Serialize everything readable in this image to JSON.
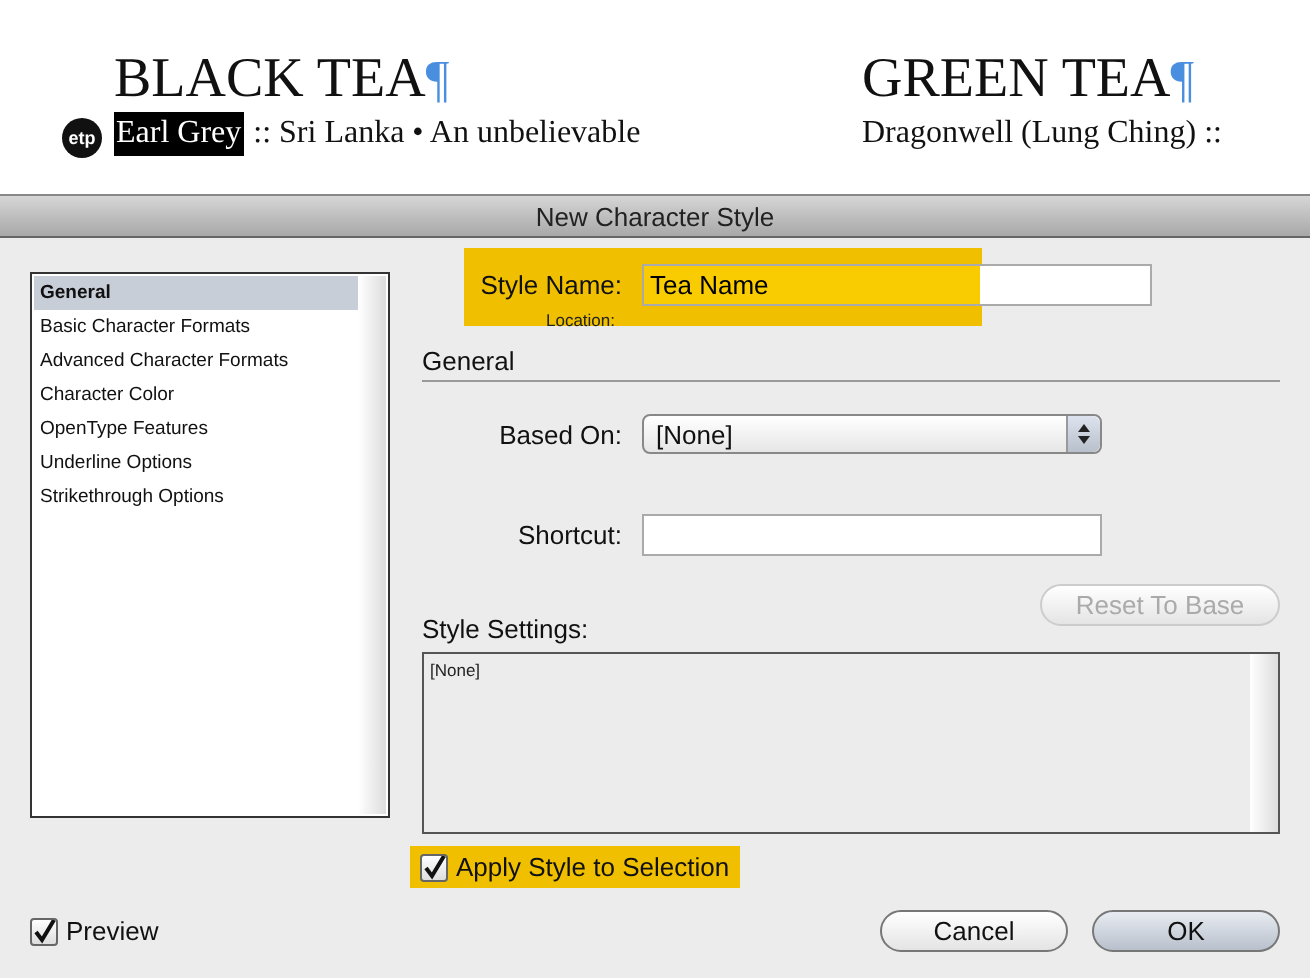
{
  "document": {
    "columns": [
      {
        "heading": "BLACK TEA",
        "pilcrow": "¶",
        "lines": [
          {
            "badge": "etp",
            "highlighted": "Earl Grey",
            "text": ":: Sri Lanka • An unbelievable"
          }
        ]
      },
      {
        "heading": "GREEN TEA",
        "pilcrow": "¶",
        "lines": [
          {
            "text": "Dragonwell (Lung Ching) ::"
          }
        ]
      }
    ]
  },
  "dialog": {
    "title": "New Character Style",
    "categories": [
      {
        "label": "General",
        "selected": true
      },
      {
        "label": "Basic Character Formats",
        "selected": false
      },
      {
        "label": "Advanced Character Formats",
        "selected": false
      },
      {
        "label": "Character Color",
        "selected": false
      },
      {
        "label": "OpenType Features",
        "selected": false
      },
      {
        "label": "Underline Options",
        "selected": false
      },
      {
        "label": "Strikethrough Options",
        "selected": false
      }
    ],
    "style_name": {
      "label": "Style Name:",
      "value": "Tea Name",
      "highlighted": true
    },
    "location_label": "Location:",
    "section": "General",
    "based_on": {
      "label": "Based On:",
      "value": "[None]"
    },
    "shortcut": {
      "label": "Shortcut:"
    },
    "reset_button": {
      "label": "Reset To Base",
      "disabled": true
    },
    "style_settings": {
      "label": "Style Settings:",
      "content": "[None]"
    },
    "apply_checkbox": {
      "label": "Apply Style to Selection",
      "checked": true,
      "highlighted": true
    },
    "preview_checkbox": {
      "label": "Preview",
      "checked": true
    },
    "buttons": [
      {
        "label": "Cancel",
        "default": false
      },
      {
        "label": "OK",
        "default": true
      }
    ]
  }
}
